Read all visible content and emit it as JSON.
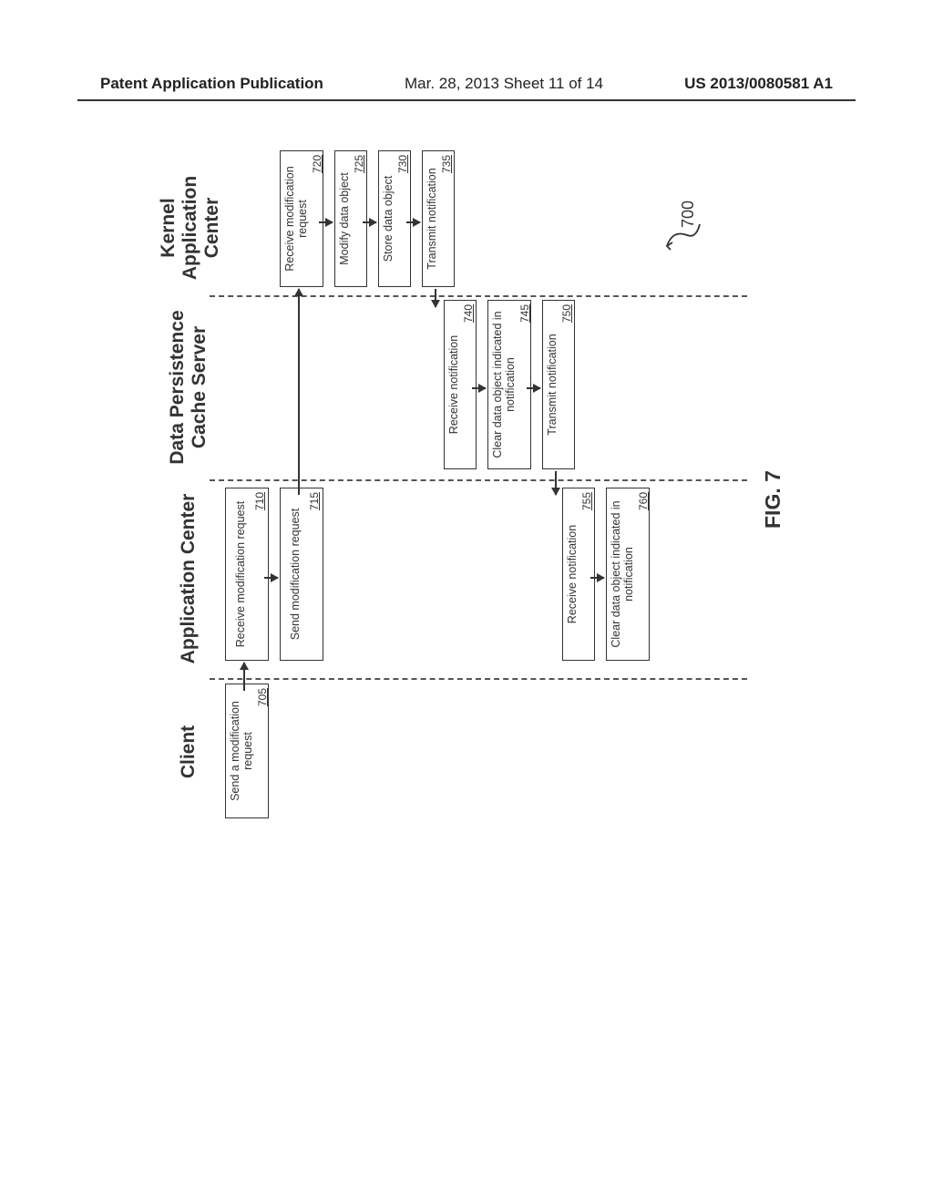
{
  "header": {
    "left": "Patent Application Publication",
    "center": "Mar. 28, 2013  Sheet 11 of 14",
    "right": "US 2013/0080581 A1"
  },
  "lanes": {
    "client": "Client",
    "appcenter": "Application Center",
    "dpcache_l1": "Data Persistence",
    "dpcache_l2": "Cache Server",
    "kernel_l1": "Kernel",
    "kernel_l2": "Application",
    "kernel_l3": "Center"
  },
  "boxes": {
    "b705": {
      "label": "Send a modification request",
      "num": "705"
    },
    "b710": {
      "label": "Receive modification request",
      "num": "710"
    },
    "b715": {
      "label": "Send modification request",
      "num": "715"
    },
    "b720": {
      "label": "Receive modification request",
      "num": "720"
    },
    "b725": {
      "label": "Modify data object",
      "num": "725"
    },
    "b730": {
      "label": "Store data object",
      "num": "730"
    },
    "b735": {
      "label": "Transmit notification",
      "num": "735"
    },
    "b740": {
      "label": "Receive notification",
      "num": "740"
    },
    "b745": {
      "label": "Clear data object indicated in notification",
      "num": "745"
    },
    "b750": {
      "label": "Transmit notification",
      "num": "750"
    },
    "b755": {
      "label": "Receive notification",
      "num": "755"
    },
    "b760": {
      "label": "Clear data object indicated in notification",
      "num": "760"
    }
  },
  "figure": {
    "label": "FIG. 7",
    "ref": "700"
  }
}
